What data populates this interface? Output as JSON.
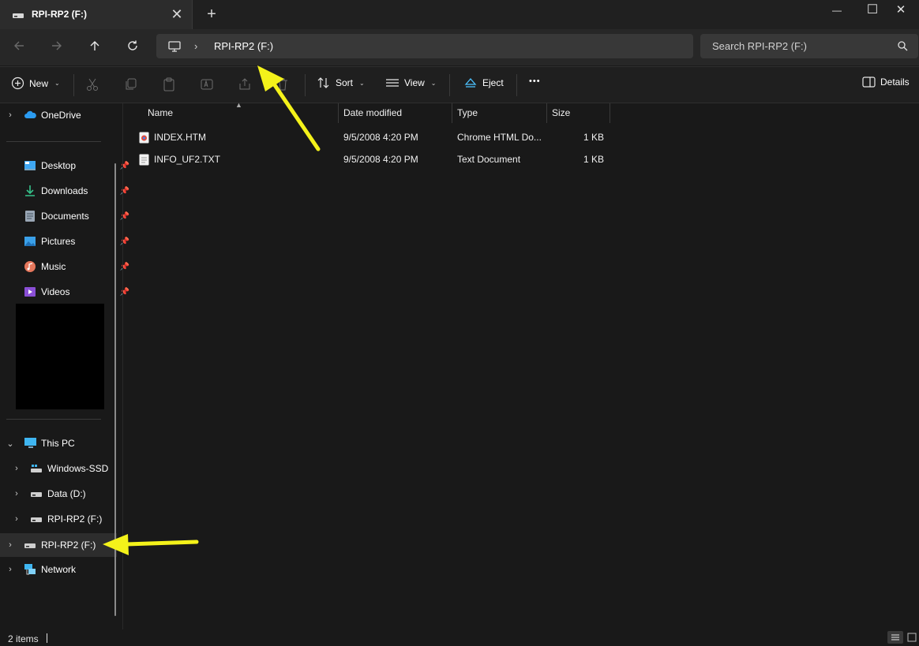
{
  "tab": {
    "title": "RPI-RP2 (F:)",
    "close_glyph": "✕",
    "new_tab_glyph": "+"
  },
  "window_controls": {
    "minimize": "—",
    "maximize": "☐",
    "close": "✕"
  },
  "address_bar": {
    "separator": "›",
    "location": "RPI-RP2 (F:)"
  },
  "search": {
    "placeholder": "Search RPI-RP2 (F:)"
  },
  "toolbar": {
    "new_label": "New",
    "sort_label": "Sort",
    "view_label": "View",
    "eject_label": "Eject",
    "more_label": "•••",
    "details_label": "Details"
  },
  "sidebar": {
    "onedrive": "OneDrive",
    "quick_access": [
      {
        "label": "Desktop",
        "icon": "desktop-icon"
      },
      {
        "label": "Downloads",
        "icon": "downloads-icon"
      },
      {
        "label": "Documents",
        "icon": "documents-icon"
      },
      {
        "label": "Pictures",
        "icon": "pictures-icon"
      },
      {
        "label": "Music",
        "icon": "music-icon"
      },
      {
        "label": "Videos",
        "icon": "videos-icon"
      }
    ],
    "this_pc": "This PC",
    "drives": [
      "Windows-SSD",
      "Data (D:)",
      "RPI-RP2 (F:)"
    ],
    "removable": "RPI-RP2 (F:)",
    "network": "Network",
    "pin_glyph": "📌"
  },
  "columns": {
    "name": "Name",
    "date": "Date modified",
    "type": "Type",
    "size": "Size"
  },
  "files": [
    {
      "name": "INDEX.HTM",
      "date": "9/5/2008 4:20 PM",
      "type": "Chrome HTML Do...",
      "size": "1 KB",
      "icon": "chrome-html-file-icon"
    },
    {
      "name": "INFO_UF2.TXT",
      "date": "9/5/2008 4:20 PM",
      "type": "Text Document",
      "size": "1 KB",
      "icon": "text-file-icon"
    }
  ],
  "status": {
    "item_count": "2 items"
  },
  "colors": {
    "background": "#191919",
    "accent": "#4cc2ff",
    "annotation_arrow": "#f4f21a"
  }
}
